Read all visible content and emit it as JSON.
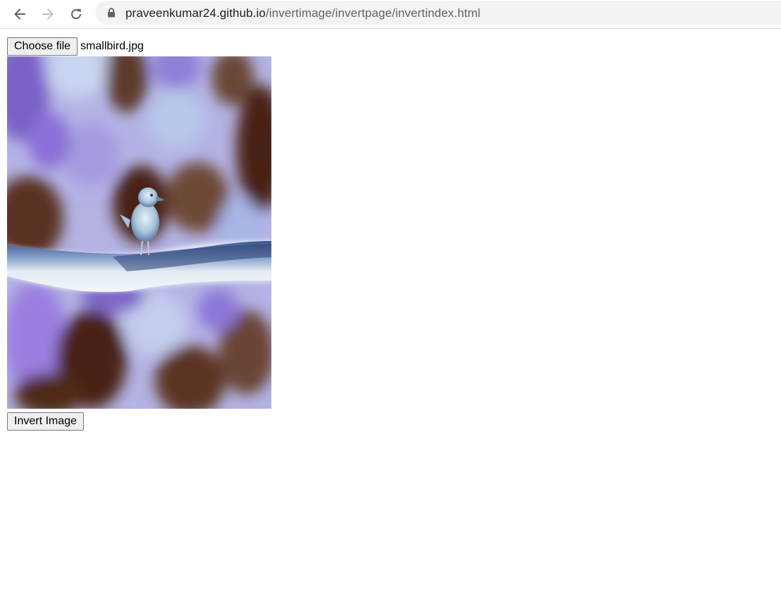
{
  "browser": {
    "url_host": "praveenkumar24.github.io",
    "url_path": "/invertimage/invertpage/invertindex.html",
    "icons": {
      "back": "arrow-left-icon",
      "forward": "arrow-right-icon",
      "reload": "reload-icon",
      "secure": "lock-icon"
    }
  },
  "page": {
    "choose_file_label": "Choose file",
    "file_name": "smallbird.jpg",
    "invert_button_label": "Invert Image",
    "image_description_colors": {
      "dark_brown": "#4a2412",
      "lavender": "#a98fe0",
      "pale_blue": "#c9d8ee",
      "branch_white": "#e8eef4",
      "branch_navy": "#2a3f73"
    }
  }
}
